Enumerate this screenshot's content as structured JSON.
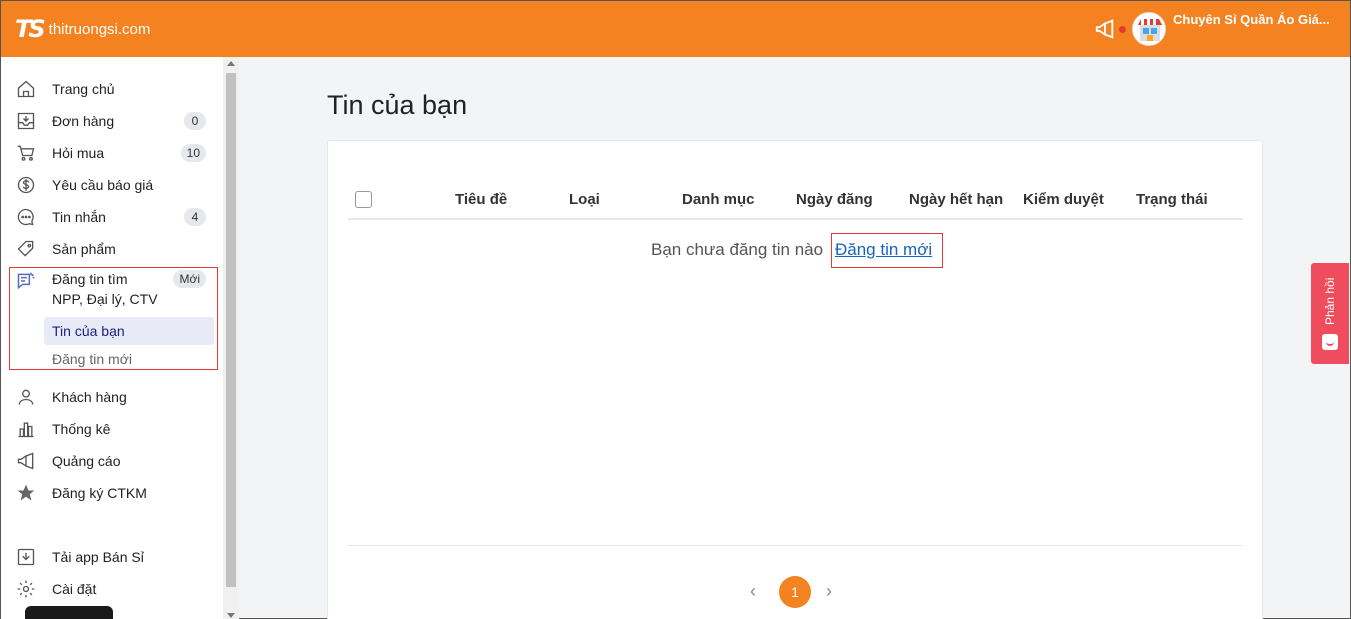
{
  "header": {
    "logo_mark": "TS",
    "logo_text": "thitruongsi.com",
    "shop_name": "Chuyên Sỉ Quần Áo Giá..."
  },
  "sidebar": {
    "items": [
      {
        "label": "Trang chủ",
        "icon": "home-icon"
      },
      {
        "label": "Đơn hàng",
        "icon": "inbox-icon",
        "badge": "0"
      },
      {
        "label": "Hỏi mua",
        "icon": "cart-icon",
        "badge": "10"
      },
      {
        "label": "Yêu cầu báo giá",
        "icon": "dollar-icon"
      },
      {
        "label": "Tin nhắn",
        "icon": "chat-icon",
        "badge": "4"
      },
      {
        "label": "Sản phẩm",
        "icon": "tag-icon"
      },
      {
        "label_line1": "Đăng tin tìm",
        "label_line2": "NPP, Đại lý, CTV",
        "icon": "post-icon",
        "badge": "Mới"
      },
      {
        "label": "Khách hàng",
        "icon": "user-icon"
      },
      {
        "label": "Thống kê",
        "icon": "chart-icon"
      },
      {
        "label": "Quảng cáo",
        "icon": "megaphone-icon"
      },
      {
        "label": "Đăng ký CTKM",
        "icon": "star-icon"
      },
      {
        "label": "Tải app Bán Sỉ",
        "icon": "download-icon"
      },
      {
        "label": "Cài đặt",
        "icon": "gear-icon"
      }
    ],
    "sub_items": [
      {
        "label": "Tin của bạn",
        "active": true
      },
      {
        "label": "Đăng tin mới",
        "active": false
      }
    ]
  },
  "main": {
    "title": "Tin của bạn",
    "table": {
      "columns": [
        "Tiêu đề",
        "Loại",
        "Danh mục",
        "Ngày đăng",
        "Ngày hết hạn",
        "Kiểm duyệt",
        "Trạng thái"
      ],
      "rows": []
    },
    "empty_message": "Bạn chưa đăng tin nào",
    "new_post_link": "Đăng tin mới",
    "pagination": {
      "current": "1",
      "prev": "‹",
      "next": "›"
    }
  },
  "feedback": {
    "label": "Phản hồi"
  },
  "colors": {
    "brand": "#f58220",
    "feedback": "#ef4d5e",
    "link": "#1565c0",
    "highlight": "#e53935"
  }
}
